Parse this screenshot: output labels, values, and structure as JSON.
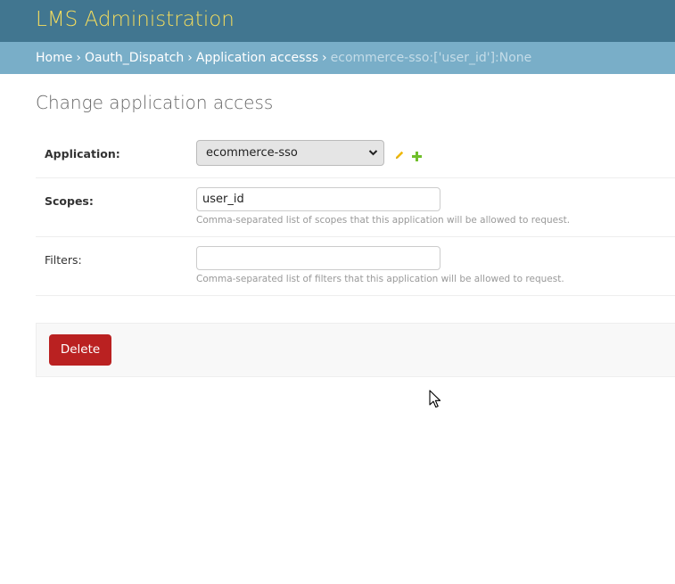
{
  "header": {
    "site_name": "LMS Administration"
  },
  "breadcrumbs": {
    "separator": "›",
    "items": [
      {
        "label": "Home"
      },
      {
        "label": "Oauth_Dispatch"
      },
      {
        "label": "Application accesss"
      }
    ],
    "current": "ecommerce-sso:['user_id']:None"
  },
  "main": {
    "title": "Change application access"
  },
  "form": {
    "application": {
      "label": "Application:",
      "selected": "ecommerce-sso",
      "edit_icon": "pencil-icon",
      "add_icon": "plus-icon"
    },
    "scopes": {
      "label": "Scopes:",
      "value": "user_id",
      "help": "Comma-separated list of scopes that this application will be allowed to request."
    },
    "filters": {
      "label": "Filters:",
      "value": "",
      "help": "Comma-separated list of filters that this application will be allowed to request."
    }
  },
  "actions": {
    "delete_label": "Delete"
  },
  "colors": {
    "header_bg": "#417690",
    "branding": "#f5dd5d",
    "breadcrumbs_bg": "#79aec8",
    "delete_bg": "#ba2121",
    "edit_icon": "#efb80b",
    "add_icon": "#70bf2b"
  }
}
